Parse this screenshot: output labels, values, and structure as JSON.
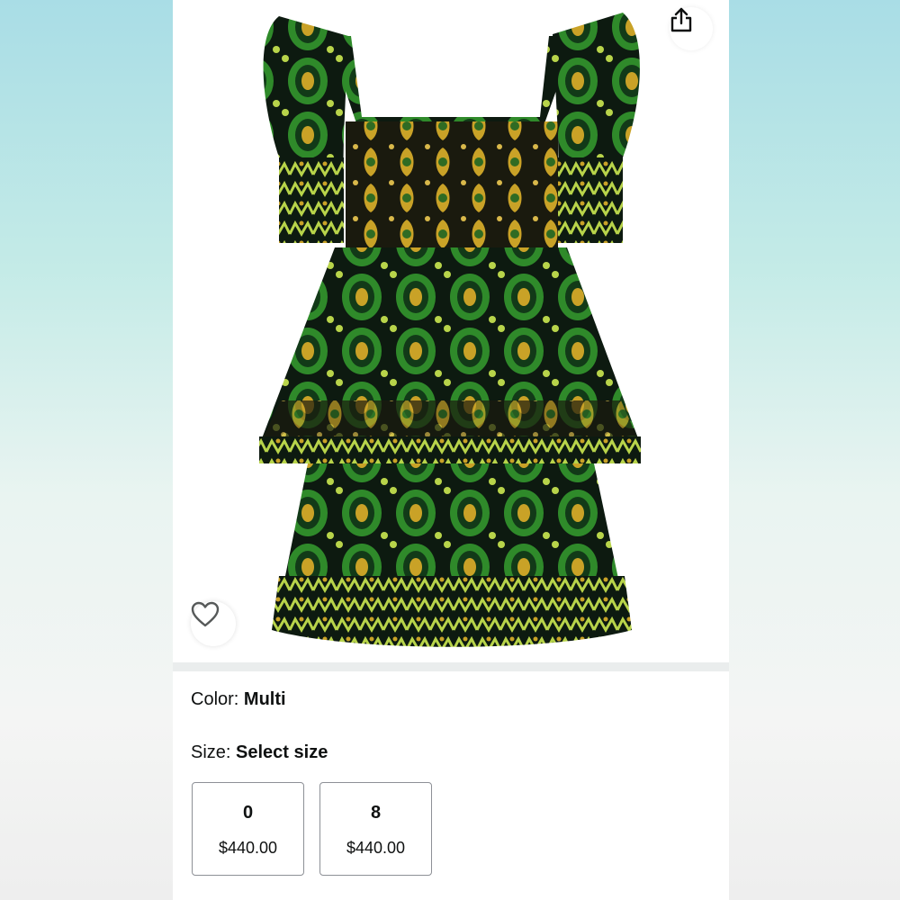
{
  "product": {
    "image_alt": "Green and black baroque print tiered mini dress",
    "share_icon": "share-icon",
    "favorite_icon": "heart-outline-icon"
  },
  "color": {
    "label": "Color: ",
    "value": "Multi"
  },
  "size": {
    "label": "Size: ",
    "value": "Select size",
    "options": [
      {
        "size": "0",
        "price": "$440.00"
      },
      {
        "size": "8",
        "price": "$440.00"
      }
    ]
  },
  "colors": {
    "text": "#0f1111",
    "divider": "#eaeded",
    "tile_border": "#8d9096",
    "dress_dark": "#0d1a10",
    "dress_green": "#2f8a2a",
    "dress_gold": "#c9a227"
  }
}
